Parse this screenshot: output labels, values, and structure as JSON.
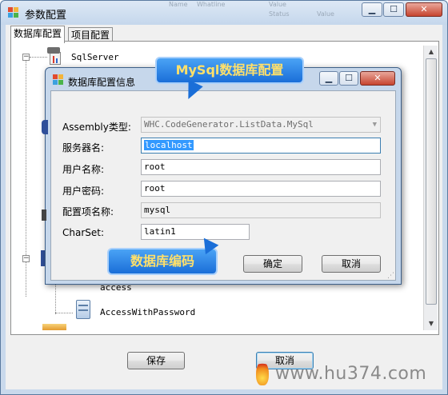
{
  "outer_window": {
    "title": "参数配置",
    "tabs": [
      {
        "label": "数据库配置",
        "active": true
      },
      {
        "label": "项目配置",
        "active": false
      }
    ],
    "tree_items": [
      "SqlServer",
      "access",
      "AccessWithPassword"
    ],
    "buttons": {
      "save": "保存",
      "cancel": "取消"
    }
  },
  "background_text": [
    "Name",
    "Whatline",
    "Value",
    "Status",
    "Value"
  ],
  "dialog": {
    "title": "数据库配置信息",
    "fields": [
      {
        "label": "Assembly类型:",
        "value": "WHC.CodeGenerator.ListData.MySql",
        "readonly": true,
        "type": "dropdown"
      },
      {
        "label": "服务器名:",
        "value": "localhost",
        "selected": true
      },
      {
        "label": "用户名称:",
        "value": "root"
      },
      {
        "label": "用户密码:",
        "value": "root"
      },
      {
        "label": "配置项名称:",
        "value": "mysql",
        "readonly": true
      },
      {
        "label": "CharSet:",
        "value": "latin1"
      }
    ],
    "buttons": {
      "ok": "确定",
      "cancel": "取消"
    }
  },
  "callouts": {
    "top": "MySql数据库配置",
    "bottom": "数据库编码"
  },
  "watermark": "www.hu374.com",
  "colors": {
    "titlebar": "#c9d9ec",
    "callout_blue": "#1a6ed8",
    "callout_yellow_text": "#ffe06a",
    "selection": "#3399ff"
  }
}
